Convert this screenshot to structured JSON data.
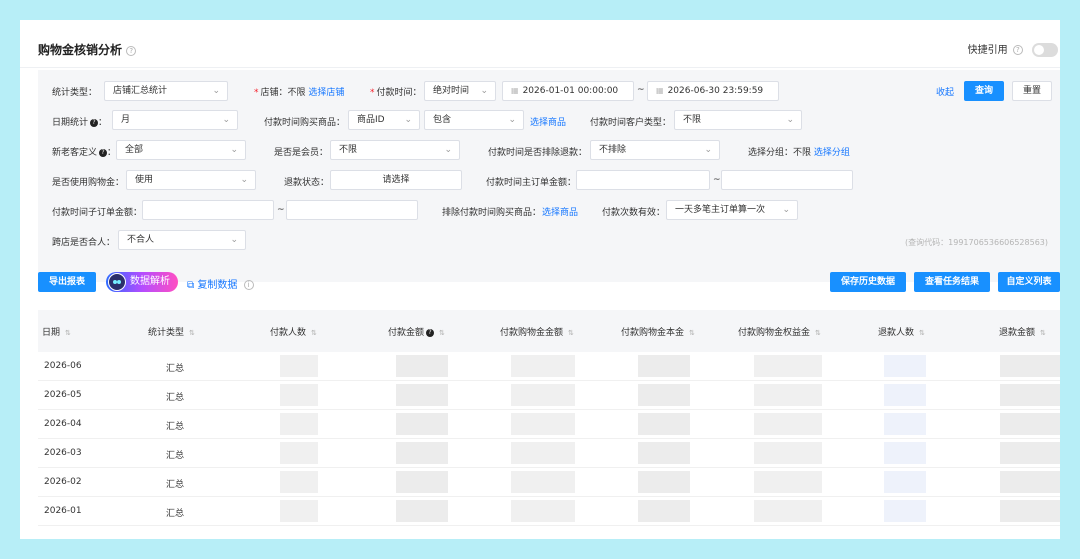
{
  "page": {
    "title": "购物金核销分析",
    "quick_ref_label": "快捷引用"
  },
  "filters": {
    "stat_type": {
      "label": "统计类型：",
      "value": "店铺汇总统计"
    },
    "store": {
      "label": "店铺：",
      "value": "不限",
      "link": "选择店铺"
    },
    "pay_time": {
      "label": "付款时间：",
      "mode": "绝对时间",
      "start": "2026-01-01 00:00:00",
      "end": "2026-06-30 23:59:59",
      "sep": "~"
    },
    "collapse": "收起",
    "query": "查询",
    "reset": "重置",
    "date_stat": {
      "label": "日期统计",
      "value": "月"
    },
    "pay_goods": {
      "label": "付款时间购买商品：",
      "type": "商品ID",
      "op": "包含",
      "link": "选择商品"
    },
    "pay_customer_type": {
      "label": "付款时间客户类型：",
      "value": "不限"
    },
    "new_old_def": {
      "label": "新老客定义",
      "value": "全部"
    },
    "is_member": {
      "label": "是否是会员：",
      "value": "不限"
    },
    "exclude_refund": {
      "label": "付款时间是否排除退款：",
      "value": "不排除"
    },
    "group": {
      "label": "选择分组：",
      "value": "不限",
      "link": "选择分组"
    },
    "use_coupon": {
      "label": "是否使用购物金：",
      "value": "使用"
    },
    "refund_status": {
      "label": "退款状态：",
      "value": "请选择"
    },
    "main_order_amount": {
      "label": "付款时间主订单金额：",
      "sep": "~"
    },
    "sub_order_amount": {
      "label": "付款时间子订单金额：",
      "sep": "~"
    },
    "exclude_goods": {
      "label": "排除付款时间购买商品：",
      "link": "选择商品"
    },
    "pay_count_valid": {
      "label": "付款次数有效：",
      "value": "一天多笔主订单算一次"
    },
    "cross_store": {
      "label": "跨店是否合人：",
      "value": "不合人"
    },
    "query_code": "(查询代码：19917065366065285­63)"
  },
  "toolbar": {
    "export": "导出报表",
    "ai": "数据解析",
    "copy": "复制数据",
    "save_history": "保存历史数据",
    "view_results": "查看任务结果",
    "custom_columns": "自定义列表"
  },
  "table": {
    "headers": [
      "日期",
      "统计类型",
      "付款人数",
      "付款金额",
      "付款购物金金额",
      "付款购物金本金",
      "付款购物金权益金",
      "退款人数",
      "退款金额"
    ],
    "rows": [
      {
        "date": "2026-06",
        "type": "汇总"
      },
      {
        "date": "2026-05",
        "type": "汇总"
      },
      {
        "date": "2026-04",
        "type": "汇总"
      },
      {
        "date": "2026-03",
        "type": "汇总"
      },
      {
        "date": "2026-02",
        "type": "汇总"
      },
      {
        "date": "2026-01",
        "type": "汇总"
      }
    ]
  }
}
